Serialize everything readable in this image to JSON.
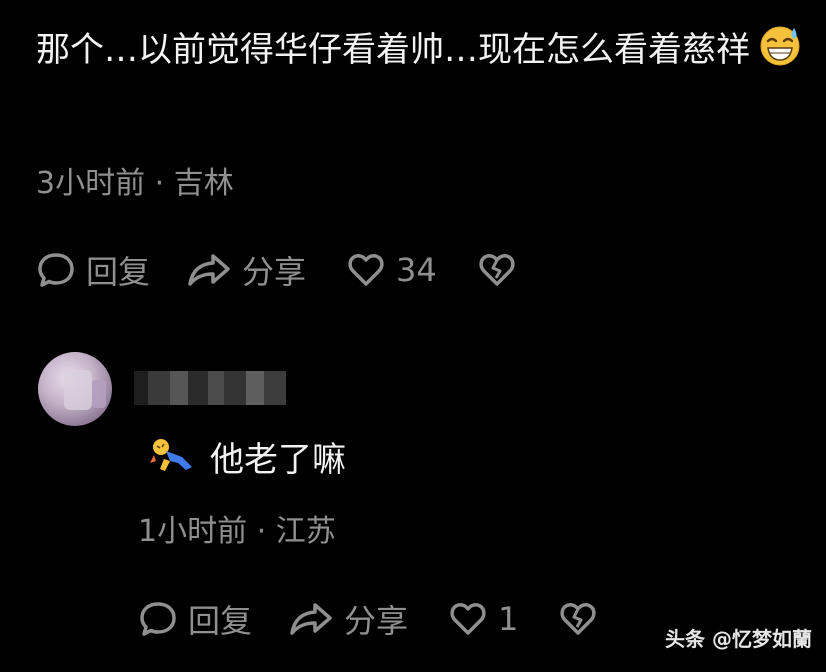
{
  "comment": {
    "text": "那个…以前觉得华仔看着帅…现在怎么看着慈祥",
    "emoji": "grinning-sweat-emoji",
    "time_location": "3小时前 · 吉林",
    "actions": {
      "reply_label": "回复",
      "share_label": "分享",
      "like_count": "34"
    }
  },
  "reply": {
    "text": "他老了嘛",
    "emoji": "flying-figure-emoji",
    "time_location": "1小时前 · 江苏",
    "actions": {
      "reply_label": "回复",
      "share_label": "分享",
      "like_count": "1"
    }
  },
  "watermark": "头条 @忆梦如蘭",
  "colors": {
    "background": "#000000",
    "text": "#f2f2f2",
    "muted": "#8f8f8f"
  }
}
